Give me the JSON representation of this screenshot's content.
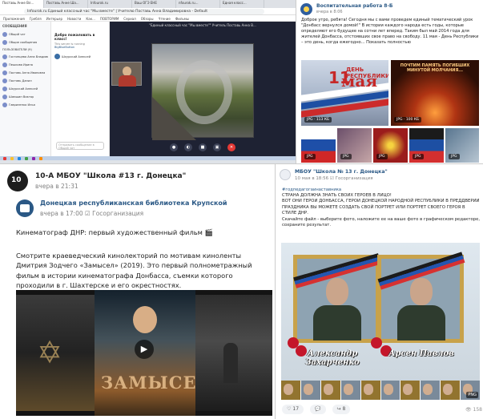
{
  "browser": {
    "tabs": [
      "Поставь Анне Вл...",
      "Поставь Анне Ша...",
      "Infourok.ru",
      "Ваш ОГЭ ЕНЕ",
      "nfourok.ru...",
      "Едная класс...",
      "ВКонтакт",
      "ЭДО YouTube"
    ],
    "url": "Infourok.ru  Единый классный час \"Мы вместе\" | Учителю Поставь Анна Владимировна - Default",
    "bookmarks": [
      "Приложения",
      "Гребля",
      "Интерьер",
      "Новости",
      "Как...",
      "ПОВТОРИМ",
      "Сериал",
      "Обзоры",
      "Чтение",
      "Фильмы"
    ]
  },
  "chat_sidebar": {
    "header": "СООБЩЕНИЯ",
    "items": [
      "Общий чат",
      "Общие сообщения",
      "ПОЛЬЗОВАТЕЛИ (9)",
      "Гостинцева Анна Владимировна",
      "Пешкова Ирина",
      "Поставь Анна Ивановна",
      "Поставь Данил",
      "Шкурский Алексей",
      "Шамшин Виктор",
      "Гавриленко Илья"
    ]
  },
  "chat_main": {
    "welcome": "Добро пожаловать в класс!",
    "sub": "This server is running",
    "sub2": "BigBlueButton",
    "member": "Шкурский Алексей",
    "input_placeholder": "Отправить сообщение в Общий чат"
  },
  "video": {
    "title": "\"Единый классный час \"Мы вместе\"\" Учитель Поставь Анна В..."
  },
  "post_top": {
    "author": "Воспитательная работа 8-Б",
    "date": "вчера в 8:06",
    "text": "Доброе утро, ребята! Сегодня мы с вами проведем единый тематический урок \"Донбасс вернулся домой!\" В истории каждого народа есть годы, которые определяют его будущее на сотни лет вперед. Таким был май 2014 года для жителей Донбасса, отстоявших свое право на свободу. 11 мая - День Республики – это день, когда ежегодно... Показать полностью",
    "img1_day": "11",
    "img1_label": "ДЕНЬ РЕСПУБЛИКИ",
    "img1_month": "мая",
    "img1_badge": "JPG · 113 КБ",
    "img2_caption": "ПОЧТИМ ПАМЯТЬ ПОГИБШИХ МИНУТОЙ МОЛЧАНИЯ...",
    "img2_badge": "JPG · 100 КБ",
    "row_badge": "JPG"
  },
  "post_bl": {
    "author": "10-А МБОУ \"Школа #13 г. Донецка\"",
    "date": "вчера в 21:31",
    "repost_author": "Донецкая республиканская библиотека Крупской",
    "repost_date": "вчера в 17:00",
    "repost_tag": "Госорганизация",
    "text1": "Кинематограф ДНР: первый художественный фильм 🎬",
    "text2": "Смотрите краеведческий кинолекторий по мотивам киноленты Дмитрия Зодчего «Замысел» (2019). Это первый полнометражный фильм в истории кинематографа Донбасса, съемки которого проходили в г. Шахтерске и его окрестностях.",
    "film_title": "ЗАМЫСЕЛ"
  },
  "post_br": {
    "author": "МБОУ \"Школа № 13 г. Донецка\"",
    "date": "10 мая в 18:56",
    "tag": "Госорганизация",
    "hashtag": "#годпедагогаинаставника",
    "text1": "СТРАНА ДОЛЖНА ЗНАТЬ СВОИХ ГЕРОЕВ В ЛИЦО!",
    "text2": "ВОТ ОНИ ГЕРОИ ДОНБАССА, ГЕРОИ ДОНЕЦКОЙ НАРОДНОЙ РЕСПУБЛИКИ В ПРЕДДВЕРИИ ПРАЗДНИКА ВЫ МОЖЕТЕ СОЗДАТЬ СВОЙ ПОРТРЕТ ИЛИ ПОРТРЕТ СВОЕГО ГЕРОЯ В СТИЛЕ ДНР.",
    "text3": "Скачайте файл - выберите фото, наложите ее на ваше фото в графическом редакторе, сохраните результат.",
    "name_left": "Александр Захарченко",
    "name_right": "Арсен Павлов",
    "badge": "PNG",
    "likes": "17",
    "comments": "",
    "shares": "8",
    "views": "158"
  },
  "colors": {
    "link": "#2a5885",
    "muted": "#828282",
    "flag_red": "#cc2b2b",
    "flag_blue": "#1d4fa3"
  }
}
